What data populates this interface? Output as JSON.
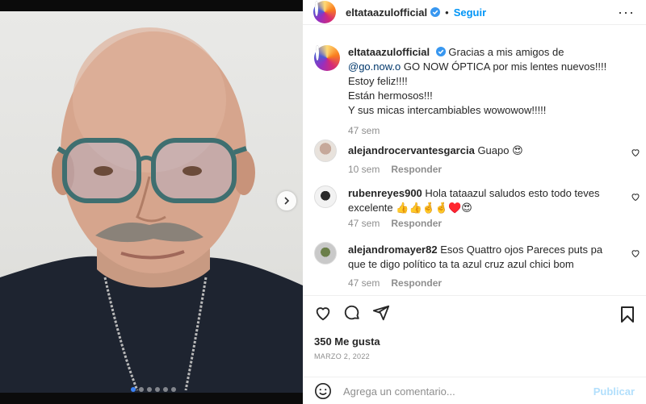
{
  "header": {
    "username": "eltataazulofficial",
    "separator": "•",
    "follow_label": "Seguir"
  },
  "carousel": {
    "slide_count": 6,
    "active_slide": 1
  },
  "caption": {
    "username": "eltataazulofficial",
    "line1_prefix": "Gracias a mis amigos de ",
    "mention": "@go.now.o",
    "line1_suffix": " GO NOW ÓPTICA por mis lentes nuevos!!!!",
    "line2": "Estoy feliz!!!!",
    "line3": "Están hermosos!!!",
    "line4": "Y sus micas intercambiables wowowow!!!!!",
    "time": "47 sem"
  },
  "comments": [
    {
      "username": "alejandrocervantesgarcia",
      "text": "Guapo 😍",
      "time": "10 sem",
      "reply": "Responder"
    },
    {
      "username": "rubenreyes900",
      "text": "Hola tataazul saludos esto todo teves excelente 👍👍🤞🤞♥️😍",
      "time": "47 sem",
      "reply": "Responder"
    },
    {
      "username": "alejandromayer82",
      "text": "Esos Quattro ojos Pareces puts pa que te digo político ta ta azul cruz azul chici bom",
      "time": "47 sem",
      "reply": "Responder"
    }
  ],
  "stats": {
    "likes": "350 Me gusta",
    "date": "MARZO 2, 2022"
  },
  "add_comment": {
    "placeholder": "Agrega un comentario...",
    "publish_label": "Publicar"
  },
  "colors": {
    "accent": "#0095f6",
    "publish_disabled": "#b2dffc",
    "muted": "#8e8e8e"
  }
}
